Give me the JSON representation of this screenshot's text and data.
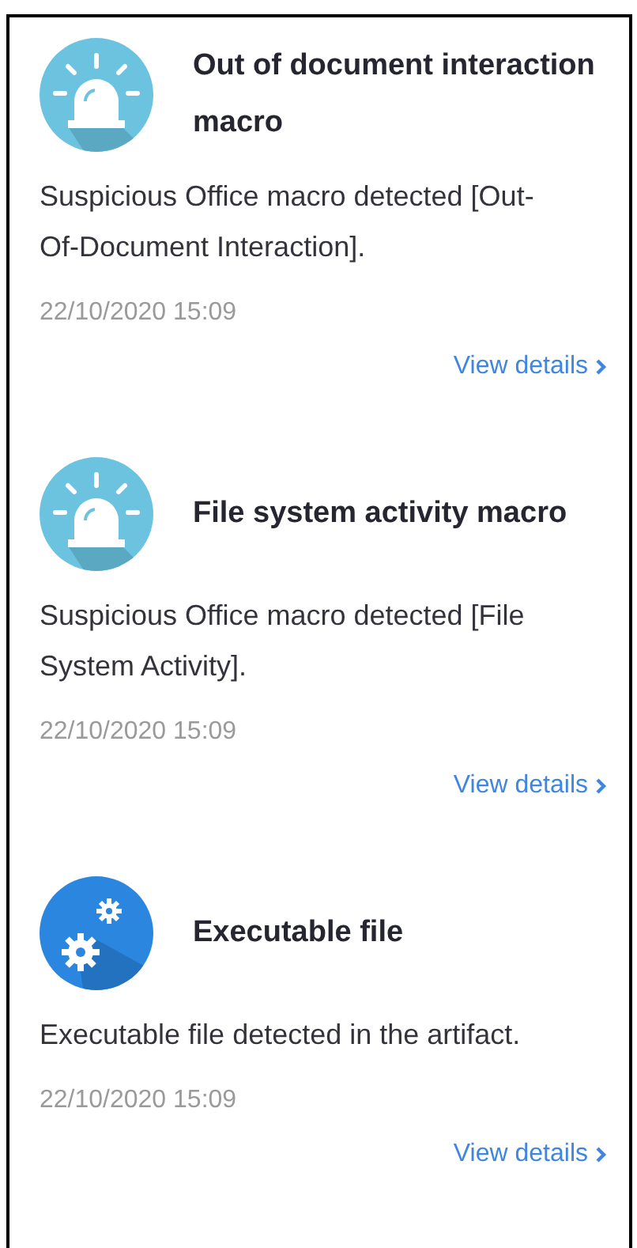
{
  "alerts": [
    {
      "kind": "alarm",
      "title": "Out of document interaction macro",
      "description": "Suspicious Office macro detected [Out-Of-Document Interaction].",
      "time": "22/10/2020 15:09",
      "link": "View details"
    },
    {
      "kind": "alarm",
      "title": "File system activity macro",
      "description": "Suspicious Office macro detected [File System Activity].",
      "time": "22/10/2020 15:09",
      "link": "View details"
    },
    {
      "kind": "gears",
      "title": "Executable file",
      "description": "Executable file detected in the artifact.",
      "time": "22/10/2020 15:09",
      "link": "View details"
    }
  ]
}
